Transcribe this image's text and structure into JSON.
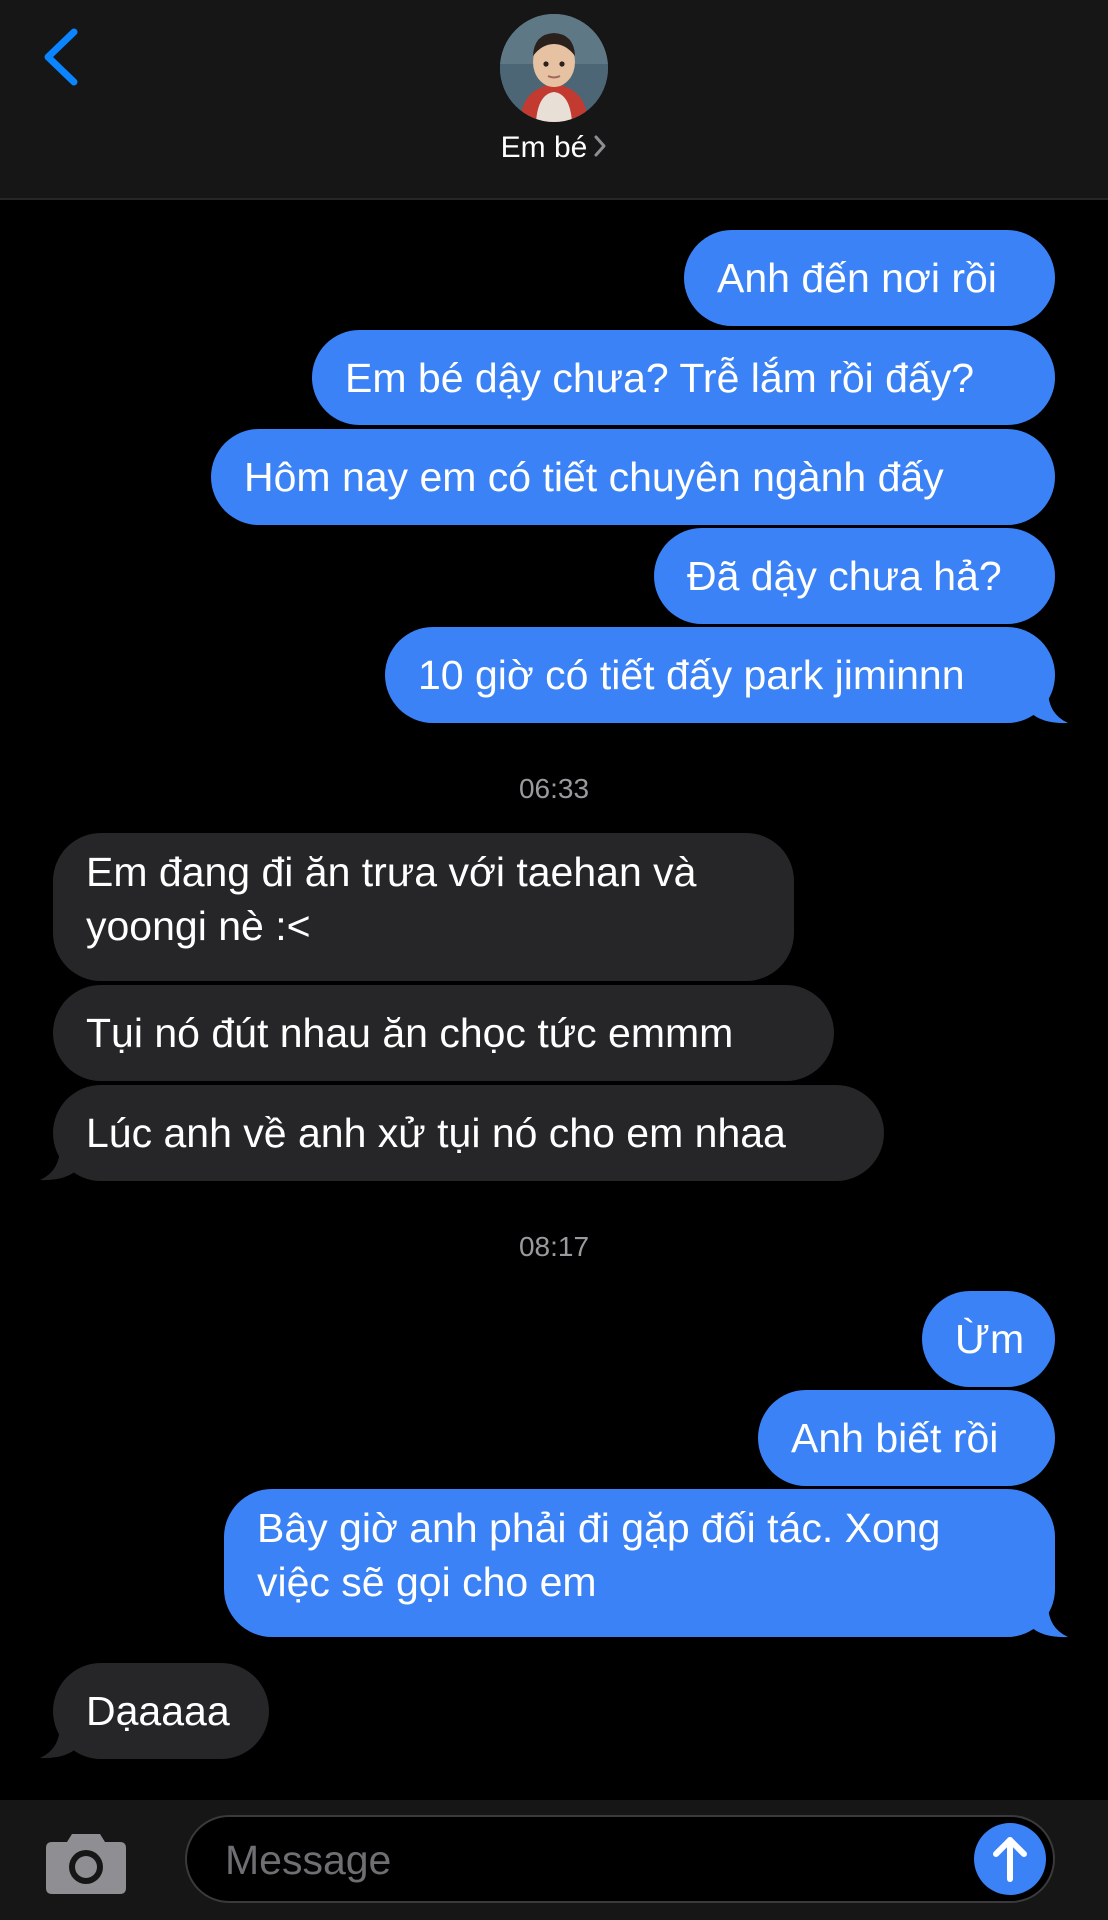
{
  "header": {
    "contact_name": "Em bé",
    "icons": {
      "back": "chevron-left-icon",
      "avatar": "contact-avatar",
      "disclosure": "chevron-right-icon"
    }
  },
  "messages": [
    {
      "side": "out",
      "text": "Anh đến nơi rồi"
    },
    {
      "side": "out",
      "text": "Em bé dậy chưa? Trễ lắm rồi đấy?"
    },
    {
      "side": "out",
      "text": "Hôm nay em có tiết chuyên ngành đấy"
    },
    {
      "side": "out",
      "text": "Đã dậy chưa hả?"
    },
    {
      "side": "out",
      "text": "10 giờ có tiết đấy park jiminnn"
    },
    {
      "side": "in",
      "text": "Em đang đi ăn trưa với taehan và yoongi nè :<"
    },
    {
      "side": "in",
      "text": "Tụi nó đút nhau ăn chọc tức emmm"
    },
    {
      "side": "in",
      "text": "Lúc anh về anh xử tụi nó cho em nhaa"
    },
    {
      "side": "out",
      "text": "Ừm"
    },
    {
      "side": "out",
      "text": "Anh biết rồi"
    },
    {
      "side": "out",
      "text": "Bây giờ anh phải đi gặp đối tác. Xong việc sẽ gọi cho em"
    },
    {
      "side": "in",
      "text": "Dạaaaa"
    }
  ],
  "timestamps": [
    "06:33",
    "08:17"
  ],
  "input": {
    "placeholder": "Message"
  },
  "icons": {
    "camera": "camera-icon",
    "send": "arrow-up-icon"
  },
  "colors": {
    "outgoing_bubble": "#3b82f6",
    "incoming_bubble": "#262628",
    "accent": "#0a84ff",
    "background": "#000000"
  }
}
